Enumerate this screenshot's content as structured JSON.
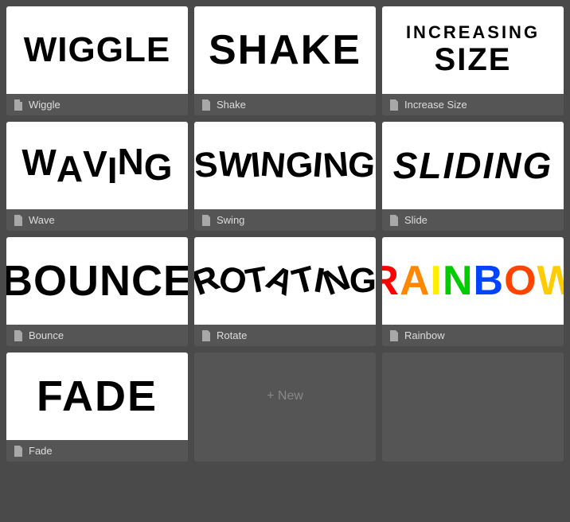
{
  "cards": [
    {
      "id": "wiggle",
      "label": "Wiggle",
      "preview_text": "WIGGLE"
    },
    {
      "id": "shake",
      "label": "Shake",
      "preview_text": "SHAKE"
    },
    {
      "id": "increase-size",
      "label": "Increase Size",
      "preview_text_line1": "INCREASING",
      "preview_text_line2": "SIZE"
    },
    {
      "id": "wave",
      "label": "Wave",
      "preview_text": "WAVING"
    },
    {
      "id": "swing",
      "label": "Swing",
      "preview_text": "SWINGING"
    },
    {
      "id": "slide",
      "label": "Slide",
      "preview_text": "SLIDING"
    },
    {
      "id": "bounce",
      "label": "Bounce",
      "preview_text": "BOUNCE"
    },
    {
      "id": "rotate",
      "label": "Rotate",
      "preview_text": "ROTATING"
    },
    {
      "id": "rainbow",
      "label": "Rainbow",
      "preview_text": "RAINBOW"
    },
    {
      "id": "fade",
      "label": "Fade",
      "preview_text": "FADE"
    }
  ],
  "new_button_label": "+ New",
  "doc_icon": "📄"
}
